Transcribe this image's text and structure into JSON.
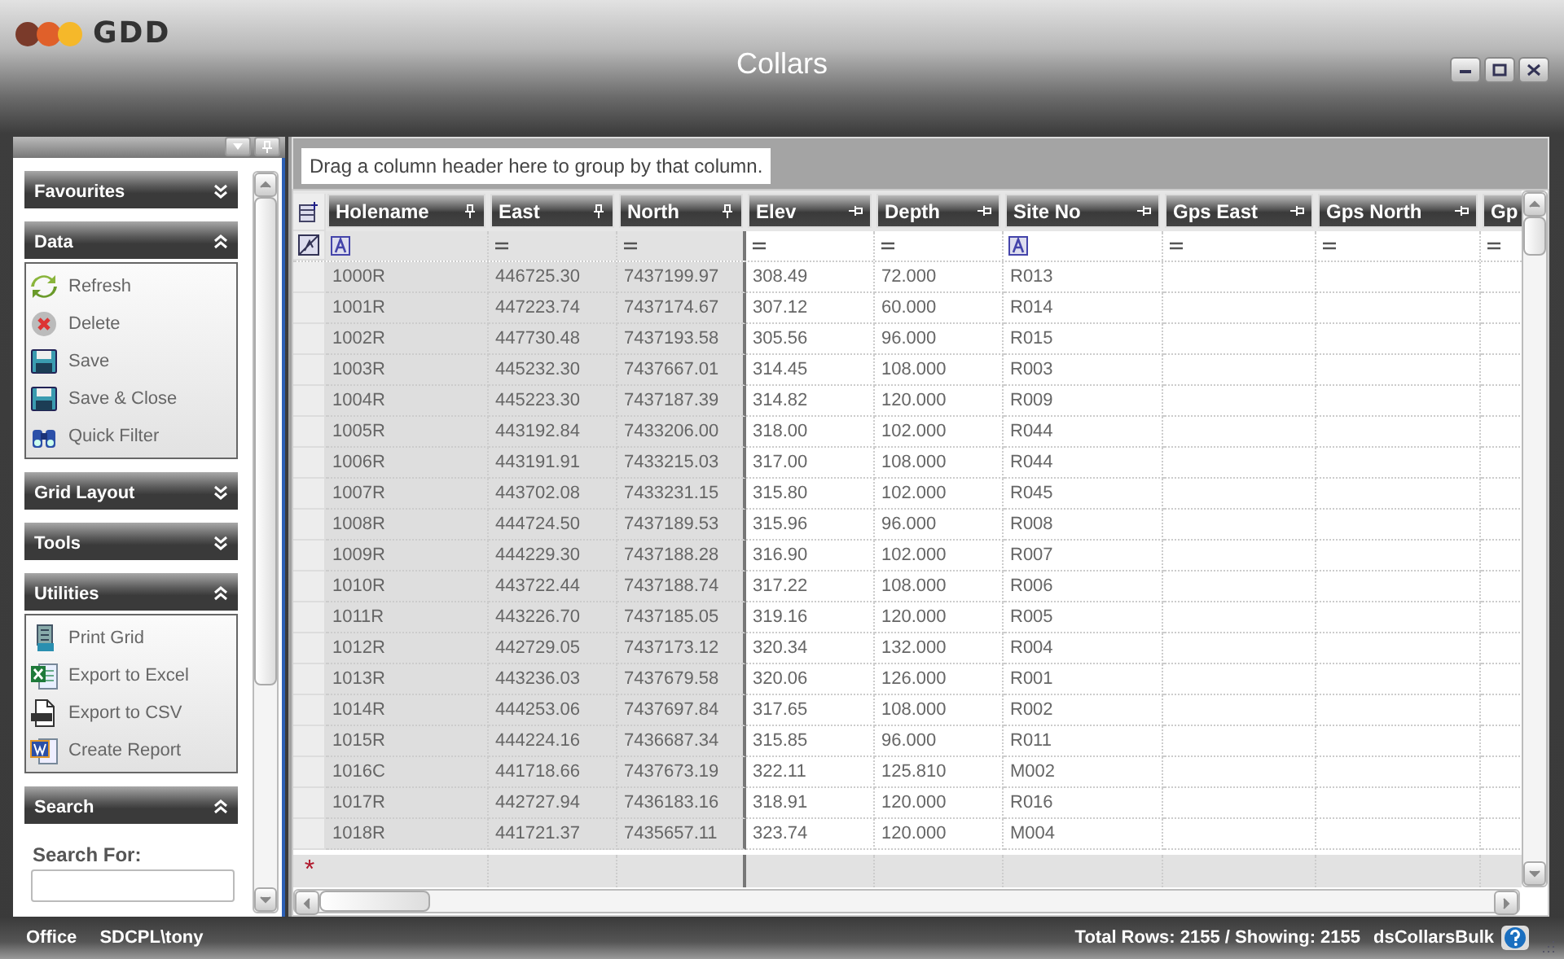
{
  "app": {
    "logo_text": "GDD"
  },
  "window": {
    "title": "Collars"
  },
  "sidebar": {
    "groups": [
      {
        "title": "Favourites",
        "expanded": false,
        "kind": "actions"
      },
      {
        "title": "Data",
        "expanded": true,
        "kind": "actions",
        "items": [
          {
            "label": "Refresh",
            "kind": "refresh"
          },
          {
            "label": "Delete",
            "kind": "delete"
          },
          {
            "label": "Save",
            "kind": "save"
          },
          {
            "label": "Save & Close",
            "kind": "save"
          },
          {
            "label": "Quick Filter",
            "kind": "binoculars"
          }
        ]
      },
      {
        "title": "Grid Layout",
        "expanded": false,
        "kind": "actions"
      },
      {
        "title": "Tools",
        "expanded": false,
        "kind": "actions"
      },
      {
        "title": "Utilities",
        "expanded": true,
        "kind": "actions",
        "items": [
          {
            "label": "Print Grid",
            "kind": "print"
          },
          {
            "label": "Export to Excel",
            "kind": "excel"
          },
          {
            "label": "Export to CSV",
            "kind": "csv"
          },
          {
            "label": "Create Report",
            "kind": "word"
          }
        ]
      },
      {
        "title": "Search",
        "expanded": true,
        "kind": "search",
        "field_label": "Search For:"
      }
    ]
  },
  "grid": {
    "group_by_hint": "Drag a column header here to group by that column.",
    "columns": [
      {
        "label": "Holename",
        "fixed": true,
        "kind": "text"
      },
      {
        "label": "East",
        "fixed": true,
        "kind": "number"
      },
      {
        "label": "North",
        "fixed": true,
        "kind": "number"
      },
      {
        "label": "Elev",
        "fixed": false,
        "kind": "number"
      },
      {
        "label": "Depth",
        "fixed": false,
        "kind": "number"
      },
      {
        "label": "Site No",
        "fixed": false,
        "kind": "text"
      },
      {
        "label": "Gps East",
        "fixed": false,
        "kind": "number"
      },
      {
        "label": "Gps North",
        "fixed": false,
        "kind": "number"
      },
      {
        "label": "Gp",
        "fixed": false,
        "kind": "number"
      }
    ],
    "rows": [
      [
        "1000R",
        "446725.30",
        "7437199.97",
        "308.49",
        "72.000",
        "R013"
      ],
      [
        "1001R",
        "447223.74",
        "7437174.67",
        "307.12",
        "60.000",
        "R014"
      ],
      [
        "1002R",
        "447730.48",
        "7437193.58",
        "305.56",
        "96.000",
        "R015"
      ],
      [
        "1003R",
        "445232.30",
        "7437667.01",
        "314.45",
        "108.000",
        "R003"
      ],
      [
        "1004R",
        "445223.30",
        "7437187.39",
        "314.82",
        "120.000",
        "R009"
      ],
      [
        "1005R",
        "443192.84",
        "7433206.00",
        "318.00",
        "102.000",
        "R044"
      ],
      [
        "1006R",
        "443191.91",
        "7433215.03",
        "317.00",
        "108.000",
        "R044"
      ],
      [
        "1007R",
        "443702.08",
        "7433231.15",
        "315.80",
        "102.000",
        "R045"
      ],
      [
        "1008R",
        "444724.50",
        "7437189.53",
        "315.96",
        "96.000",
        "R008"
      ],
      [
        "1009R",
        "444229.30",
        "7437188.28",
        "316.90",
        "102.000",
        "R007"
      ],
      [
        "1010R",
        "443722.44",
        "7437188.74",
        "317.22",
        "108.000",
        "R006"
      ],
      [
        "1011R",
        "443226.70",
        "7437185.05",
        "319.16",
        "120.000",
        "R005"
      ],
      [
        "1012R",
        "442729.05",
        "7437173.12",
        "320.34",
        "132.000",
        "R004"
      ],
      [
        "1013R",
        "443236.03",
        "7437679.58",
        "320.06",
        "126.000",
        "R001"
      ],
      [
        "1014R",
        "444253.06",
        "7437697.84",
        "317.65",
        "108.000",
        "R002"
      ],
      [
        "1015R",
        "444224.16",
        "7436687.34",
        "315.85",
        "96.000",
        "R011"
      ],
      [
        "1016C",
        "441718.66",
        "7437673.19",
        "322.11",
        "125.810",
        "M002"
      ],
      [
        "1017R",
        "442727.94",
        "7436183.16",
        "318.91",
        "120.000",
        "R016"
      ],
      [
        "1018R",
        "441721.37",
        "7435657.11",
        "323.74",
        "120.000",
        "M004"
      ]
    ],
    "new_row_marker": "*"
  },
  "status_bar": {
    "left": [
      "Office",
      "SDCPL\\tony"
    ],
    "totals": "Total Rows: 2155 / Showing: 2155",
    "dataset": "dsCollarsBulk"
  }
}
